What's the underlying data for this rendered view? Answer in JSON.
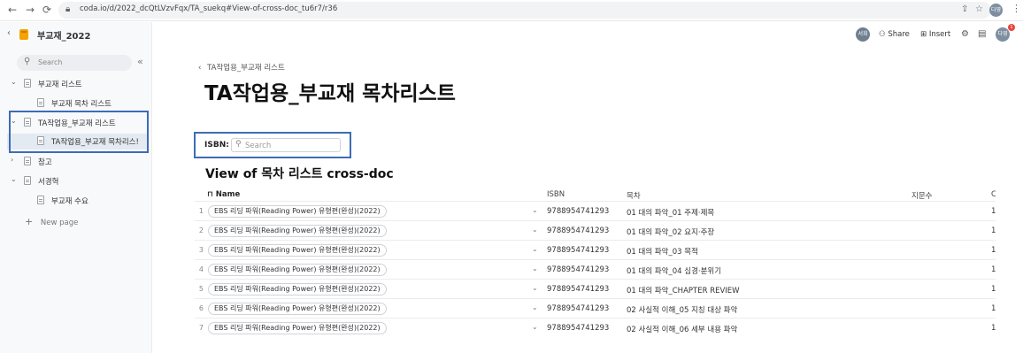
{
  "browser": {
    "url": "coda.io/d/2022_dcQtLVzvFqx/TA_suekq#View-of-cross-doc_tu6r7/r36",
    "profile_initials": "다영"
  },
  "sidebar": {
    "doc_title": "부교재_2022",
    "search_placeholder": "Search",
    "collapse_glyph": "«",
    "items": [
      {
        "label": "부교재 리스트",
        "expanded": true
      },
      {
        "label": "부교재 목차 리스트"
      },
      {
        "label": "TA작업용_부교재 리스트",
        "expanded": true
      },
      {
        "label": "TA작업용_부교재 목차리스!",
        "selected": true
      },
      {
        "label": "참고",
        "expanded": false
      },
      {
        "label": "서경혁",
        "expanded": true
      },
      {
        "label": "부교재 수요"
      }
    ],
    "new_page": "New page"
  },
  "toolbar": {
    "avatar_1": "서희",
    "share": "Share",
    "insert": "Insert",
    "avatar_2": "다영",
    "notification_count": "1",
    "colors": {
      "avatar_1": "#6f7f90",
      "avatar_2": "#7e8ea0"
    }
  },
  "main": {
    "breadcrumb": "TA작업용_부교재 리스트",
    "page_title": "TA작업용_부교재 목차리스트",
    "filter_label": "ISBN:",
    "filter_placeholder": "Search",
    "view_title": "View of 목차 리스트 cross-doc"
  },
  "table": {
    "headers": {
      "name": "Name",
      "isbn": "ISBN",
      "toc": "목차",
      "passages": "지문수",
      "cut": "C"
    },
    "rows": [
      {
        "num": "1",
        "name": "EBS 리딩 파워(Reading Power) 유형편(완성)(2022)",
        "isbn": "9788954741293",
        "toc": "01 대의 파악_01 주제·제목",
        "c": "1"
      },
      {
        "num": "2",
        "name": "EBS 리딩 파워(Reading Power) 유형편(완성)(2022)",
        "isbn": "9788954741293",
        "toc": "01 대의 파악_02 요지·주장",
        "c": "1"
      },
      {
        "num": "3",
        "name": "EBS 리딩 파워(Reading Power) 유형편(완성)(2022)",
        "isbn": "9788954741293",
        "toc": "01 대의 파악_03 목적",
        "c": "1"
      },
      {
        "num": "4",
        "name": "EBS 리딩 파워(Reading Power) 유형편(완성)(2022)",
        "isbn": "9788954741293",
        "toc": "01 대의 파악_04 심경·분위기",
        "c": "1"
      },
      {
        "num": "5",
        "name": "EBS 리딩 파워(Reading Power) 유형편(완성)(2022)",
        "isbn": "9788954741293",
        "toc": "01 대의 파악_CHAPTER REVIEW",
        "c": "1"
      },
      {
        "num": "6",
        "name": "EBS 리딩 파워(Reading Power) 유형편(완성)(2022)",
        "isbn": "9788954741293",
        "toc": "02 사실적 이해_05 지칭 대상 파악",
        "c": "1"
      },
      {
        "num": "7",
        "name": "EBS 리딩 파워(Reading Power) 유형편(완성)(2022)",
        "isbn": "9788954741293",
        "toc": "02 사실적 이해_06 세부 내용 파악",
        "c": "1"
      }
    ]
  }
}
